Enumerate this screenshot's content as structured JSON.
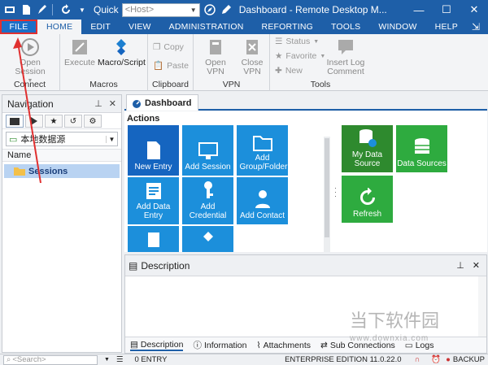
{
  "titlebar": {
    "quick_label": "Quick",
    "host_placeholder": "<Host>",
    "title": "Dashboard - Remote Desktop M...",
    "icons": [
      "app-icon",
      "document-icon",
      "edit-icon",
      "refresh-icon"
    ],
    "window_buttons": [
      "minimize-icon",
      "maximize-icon",
      "close-icon"
    ]
  },
  "menu": {
    "tabs": [
      "FILE",
      "HOME",
      "EDIT",
      "VIEW",
      "ADMINISTRATION",
      "REFORTING",
      "TOOLS",
      "WINDOW",
      "HELP"
    ],
    "active": "HOME"
  },
  "ribbon": {
    "connect": {
      "label": "Connect",
      "open_session": "Open Session"
    },
    "macros": {
      "label": "Macros",
      "execute": "Execute",
      "macro_script": "Macro/Script"
    },
    "clipboard": {
      "label": "Clipboard",
      "copy": "Copy",
      "paste": "Paste"
    },
    "vpn": {
      "label": "VPN",
      "open_vpn": "Open VPN",
      "close_vpn": "Close VPN"
    },
    "tools": {
      "label": "Tools",
      "status": "Status",
      "favorite": "Favorite",
      "new": "New",
      "insert_log": "Insert Log Comment"
    }
  },
  "navigation": {
    "title": "Navigation",
    "data_source": "本地数据源",
    "column": "Name",
    "items": [
      {
        "label": "Sessions"
      }
    ]
  },
  "dashboard": {
    "tab": "Dashboard",
    "section": "Actions",
    "tiles": [
      "New Entry",
      "Add Session",
      "Add Group/Folder",
      "Add Data Entry",
      "Add Credential",
      "Add Contact"
    ],
    "right_tiles": [
      "My Data Source",
      "Data Sources",
      "Refresh"
    ]
  },
  "description": {
    "title": "Description",
    "tabs": [
      "Description",
      "Information",
      "Attachments",
      "Sub Connections",
      "Logs"
    ]
  },
  "status": {
    "search_placeholder": "<Search>",
    "entry_count": "0 ENTRY",
    "edition": "ENTERPRISE EDITION 11.0.22.0",
    "backup": "BACKUP"
  },
  "watermark": {
    "text": "当下软件园",
    "sub": "www.downxia.com"
  },
  "colors": {
    "titlebar": "#1e5fa8",
    "tile_blue": "#1c8fdb",
    "tile_green": "#2eab3f",
    "annotation": "#e03030"
  }
}
